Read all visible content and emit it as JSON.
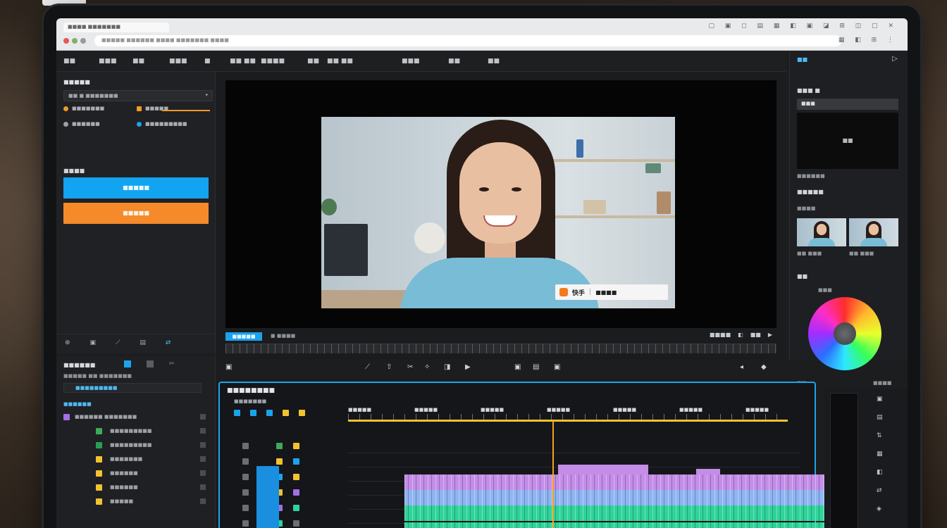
{
  "browser": {
    "tab_title": "■■■■ ■■■■■■■",
    "address": "■■■■■ ■■■■■■ ■■■■ ■■■■■■■ ■■■■"
  },
  "menubar": {
    "items": [
      "■■",
      "■■■",
      "■■",
      "■■■",
      "■",
      "■■ ■■",
      "■■■■",
      "■■",
      "■■ ■■",
      "■■■",
      "■■",
      "■■"
    ]
  },
  "left_panel": {
    "title": "■■■■■",
    "select_value": "■■  ■ ■■■■■■■",
    "options": [
      {
        "label": "■■■■■■■",
        "color": "#f39a2b"
      },
      {
        "label": "■■■■■",
        "color": "#f39a2b"
      },
      {
        "label": "■■■■■■",
        "color": "#9aa0a6"
      },
      {
        "label": "■■■■■■■■■",
        "color": "#1aa3ee"
      }
    ],
    "section_label": "■■■■",
    "primary_button": "■■■■■",
    "secondary_button": "■■■■■",
    "tools": [
      "⊕",
      "▣",
      "⟋",
      "▤",
      "⇄"
    ]
  },
  "project_panel": {
    "title": "■■■■■■",
    "subtitle": "■■■■■ ■■ ■■■■■■■",
    "search_value": "■■■■■■■■■",
    "folder": "■■■■■■",
    "rows": [
      {
        "label": "■■■■■■ ■■■■■■■",
        "color": "#a36ee6"
      },
      {
        "label": "■■■■■■■■■",
        "color": "#3ea95a"
      },
      {
        "label": "■■■■■■■■■",
        "color": "#2a9d59"
      },
      {
        "label": "■■■■■■■",
        "color": "#f2c230"
      },
      {
        "label": "■■■■■■",
        "color": "#f2c230"
      },
      {
        "label": "■■■■■■",
        "color": "#f2c230"
      },
      {
        "label": "■■■■■",
        "color": "#f2c230"
      }
    ]
  },
  "viewer": {
    "overlay_brand": "快手",
    "overlay_suffix": "|",
    "overlay_text": "■■■■",
    "timecode_badge": "■■■■■",
    "timecode_text": "■ ■■■■",
    "right_controls": [
      "■■■■",
      "◧",
      "■■",
      "▶"
    ],
    "transport": [
      "▣",
      "⟋",
      "⇧",
      "✂",
      "✧",
      "◨",
      "▶",
      "▣",
      "▤",
      "▣",
      "◂",
      "◆"
    ]
  },
  "inspector": {
    "header": "■■",
    "label_1": "■■■ ■",
    "field_1": "■■■",
    "preview_text": "■■",
    "sub_1": "■■■■■■",
    "label_2": "■■■■■",
    "label_3": "■■■■",
    "thumb_captions": [
      "■■ ■■■",
      "■■ ■■■"
    ],
    "label_4": "■■",
    "label_5": "■■■",
    "bottom_left": "■■",
    "bottom_right": "■■■■"
  },
  "timeline": {
    "title": "■■■■■■■■",
    "subtitle": "■■■■■■■",
    "ruler_labels": [
      "■■■■■",
      "■■■■■",
      "■■■■■",
      "■■■■■",
      "■■■■■",
      "■■■■■",
      "■■■■■"
    ],
    "track_icons": [
      "▣",
      "▣",
      "▣",
      "▣",
      "▣",
      "▣",
      "▣"
    ]
  },
  "colors": {
    "accent_blue": "#1aa3ee",
    "accent_orange": "#f58a2a",
    "playhead": "#f2a21c",
    "clip_purple": "#c48de8",
    "clip_blue": "#8fb4f2",
    "clip_green": "#2fd39a"
  }
}
